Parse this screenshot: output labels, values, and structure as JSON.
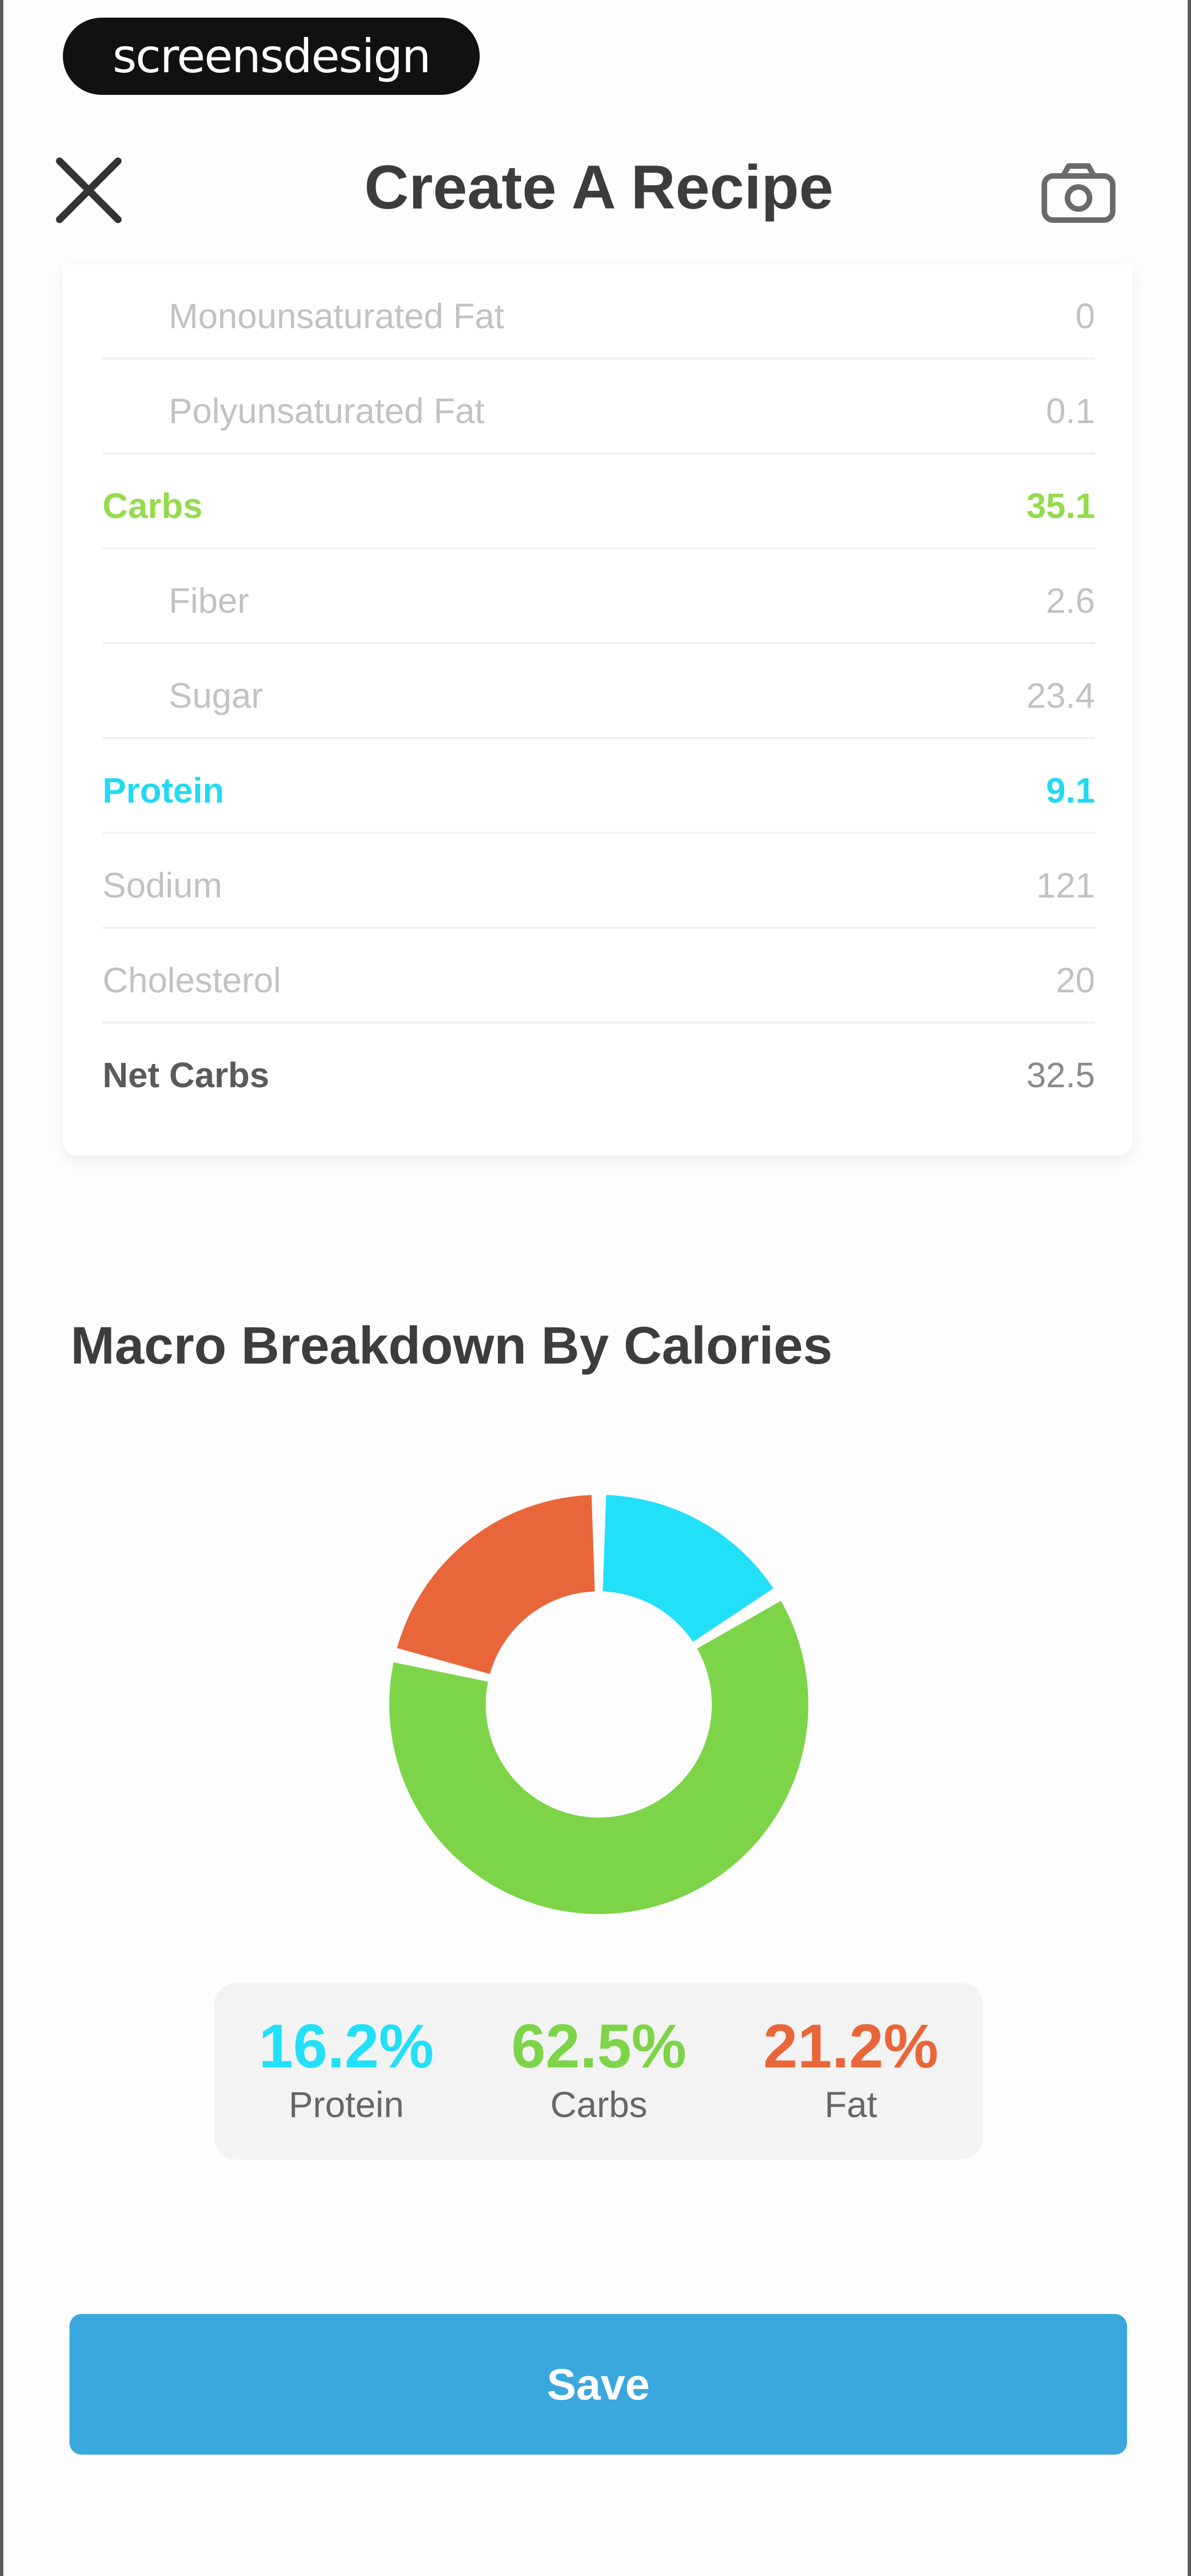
{
  "watermark": "screensdesign",
  "header": {
    "title": "Create A Recipe",
    "close_icon": "close-icon",
    "camera_icon": "camera-icon"
  },
  "nutrition": {
    "rows": [
      {
        "label": "Monounsaturated Fat",
        "value": "0"
      },
      {
        "label": "Polyunsaturated Fat",
        "value": "0.1"
      },
      {
        "label": "Carbs",
        "value": "35.1"
      },
      {
        "label": "Fiber",
        "value": "2.6"
      },
      {
        "label": "Sugar",
        "value": "23.4"
      },
      {
        "label": "Protein",
        "value": "9.1"
      },
      {
        "label": "Sodium",
        "value": "121"
      },
      {
        "label": "Cholesterol",
        "value": "20"
      },
      {
        "label": "Net Carbs",
        "value": "32.5"
      }
    ]
  },
  "macro": {
    "title": "Macro Breakdown By Calories",
    "items": [
      {
        "pct": "16.2%",
        "name": "Protein",
        "color": "#22e0f8"
      },
      {
        "pct": "62.5%",
        "name": "Carbs",
        "color": "#7ed448"
      },
      {
        "pct": "21.2%",
        "name": "Fat",
        "color": "#e8663a"
      }
    ]
  },
  "chart_data": {
    "type": "pie",
    "categories": [
      "Protein",
      "Carbs",
      "Fat"
    ],
    "values": [
      16.2,
      62.5,
      21.2
    ],
    "colors": [
      "#22e0f8",
      "#7ed448",
      "#e8663a"
    ],
    "title": "Macro Breakdown By Calories"
  },
  "actions": {
    "save_label": "Save"
  }
}
